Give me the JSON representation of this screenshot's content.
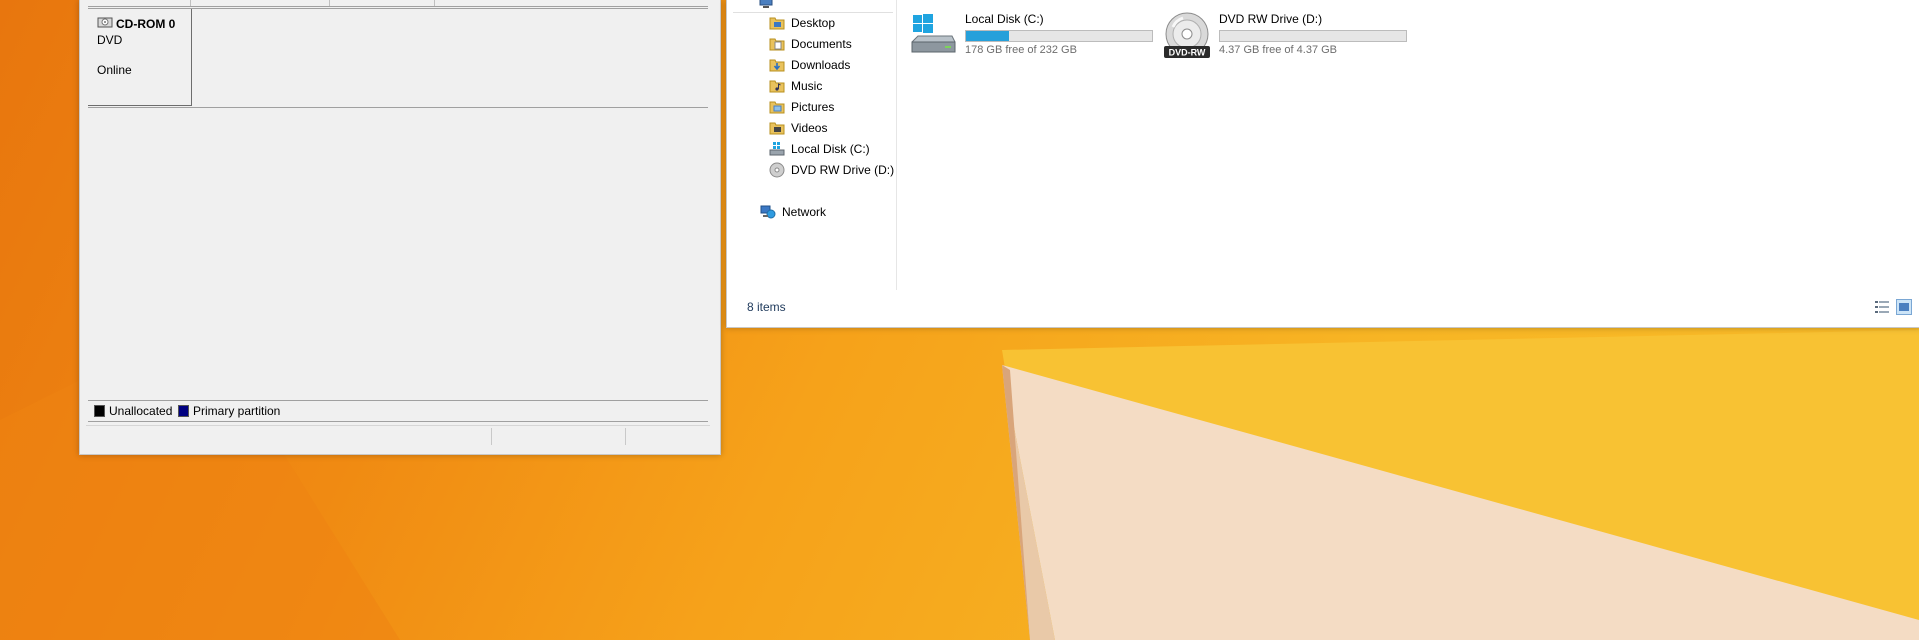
{
  "disk_management": {
    "disk": {
      "name": "CD-ROM 0",
      "type": "DVD",
      "status": "Online"
    },
    "legend": [
      {
        "label": "Unallocated",
        "color": "#000000"
      },
      {
        "label": "Primary partition",
        "color": "#000080"
      }
    ]
  },
  "explorer": {
    "nav_items": [
      {
        "label": "Desktop",
        "icon": "desktop-folder-icon"
      },
      {
        "label": "Documents",
        "icon": "documents-folder-icon"
      },
      {
        "label": "Downloads",
        "icon": "downloads-folder-icon"
      },
      {
        "label": "Music",
        "icon": "music-folder-icon"
      },
      {
        "label": "Pictures",
        "icon": "pictures-folder-icon"
      },
      {
        "label": "Videos",
        "icon": "videos-folder-icon"
      },
      {
        "label": "Local Disk (C:)",
        "icon": "local-disk-icon"
      },
      {
        "label": "DVD RW Drive (D:)",
        "icon": "dvd-drive-icon"
      }
    ],
    "network_label": "Network",
    "drives": [
      {
        "name": "Local Disk (C:)",
        "free_text": "178 GB free of 232 GB",
        "used_fraction": 0.233,
        "icon": "hard-disk-windows-icon"
      },
      {
        "name": "DVD RW Drive (D:)",
        "free_text": "4.37 GB free of 4.37 GB",
        "used_fraction": 0.0,
        "icon": "dvd-rw-icon",
        "icon_text": "DVD-RW"
      }
    ],
    "status_text": "8 items",
    "accent_color": "#26a0da"
  }
}
